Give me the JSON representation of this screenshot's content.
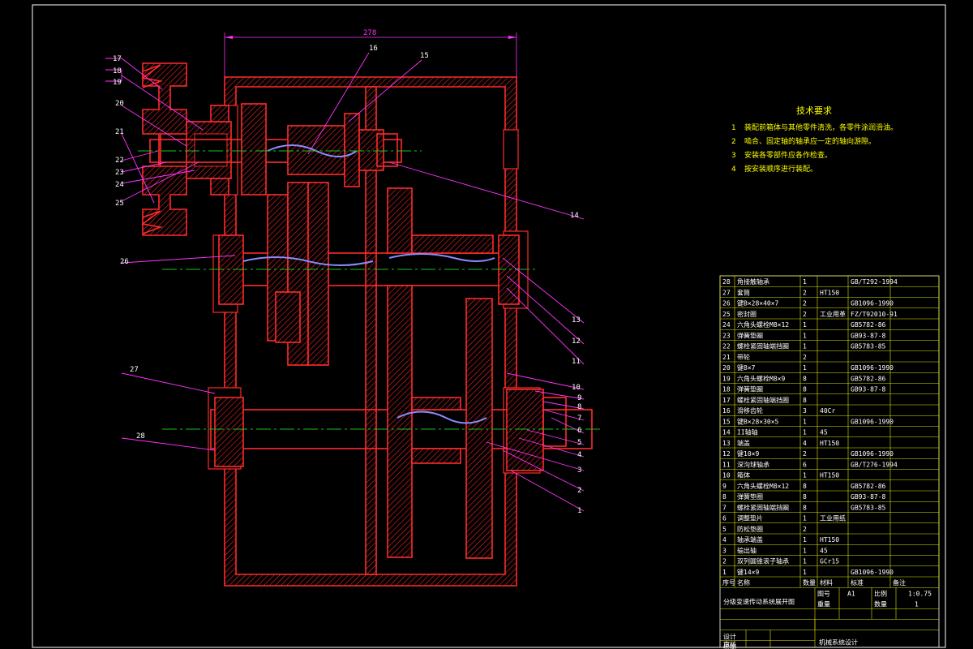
{
  "dimension": {
    "overall_width": "278"
  },
  "technical_requirements": {
    "title": "技术要求",
    "items": [
      {
        "no": "1",
        "text": "装配前箱体与其他零件清洗，各零件涂润滑油。"
      },
      {
        "no": "2",
        "text": "啮合、固定轴的轴承应一定的轴向游隙。"
      },
      {
        "no": "3",
        "text": "安装各零部件应各作检查。"
      },
      {
        "no": "4",
        "text": "按安装顺序进行装配。"
      }
    ]
  },
  "callouts": {
    "c17": "17",
    "c18": "18",
    "c19": "19",
    "c20": "20",
    "c21": "21",
    "c22": "22",
    "c23": "23",
    "c24": "24",
    "c25": "25",
    "c16a": "16",
    "c16b": "15",
    "c14": "14",
    "c26": "26",
    "c13": "13",
    "c12": "12",
    "c11": "11",
    "c27": "27",
    "c10": "10",
    "c9": "9",
    "c8": "8",
    "c7": "7",
    "c6": "6",
    "c5": "5",
    "c4": "4",
    "c3": "3",
    "c2": "2",
    "c1": "1",
    "c28": "28"
  },
  "bom": {
    "rows": [
      {
        "no": "28",
        "name": "角接触轴承",
        "qty": "1",
        "material": "",
        "standard": "GB/T292-1994",
        "note": ""
      },
      {
        "no": "27",
        "name": "套筒",
        "qty": "2",
        "material": "HT150",
        "standard": "",
        "note": ""
      },
      {
        "no": "26",
        "name": "键B×28×40×7",
        "qty": "2",
        "material": "",
        "standard": "GB1096-1990",
        "note": ""
      },
      {
        "no": "25",
        "name": "密封圈",
        "qty": "2",
        "material": "工业用革",
        "standard": "FZ/T92010-91",
        "note": ""
      },
      {
        "no": "24",
        "name": "六角头螺栓M8×12",
        "qty": "1",
        "material": "",
        "standard": "GB5782-86",
        "note": ""
      },
      {
        "no": "23",
        "name": "弹簧垫圈",
        "qty": "1",
        "material": "",
        "standard": "GB93-87-8",
        "note": ""
      },
      {
        "no": "22",
        "name": "螺栓紧固轴端挡圈",
        "qty": "1",
        "material": "",
        "standard": "GB5783-85",
        "note": ""
      },
      {
        "no": "21",
        "name": "带轮",
        "qty": "2",
        "material": "",
        "standard": "",
        "note": ""
      },
      {
        "no": "20",
        "name": "键8×7",
        "qty": "1",
        "material": "",
        "standard": "GB1096-1990",
        "note": ""
      },
      {
        "no": "19",
        "name": "六角头螺栓M8×9",
        "qty": "8",
        "material": "",
        "standard": "GB5782-86",
        "note": ""
      },
      {
        "no": "18",
        "name": "弹簧垫圈",
        "qty": "8",
        "material": "",
        "standard": "GB93-87-8",
        "note": ""
      },
      {
        "no": "17",
        "name": "螺栓紧固轴端挡圈",
        "qty": "8",
        "material": "",
        "standard": "",
        "note": ""
      },
      {
        "no": "16",
        "name": "滑移齿轮",
        "qty": "3",
        "material": "40Cr",
        "standard": "",
        "note": ""
      },
      {
        "no": "15",
        "name": "键B×28×30×5",
        "qty": "1",
        "material": "",
        "standard": "GB1096-1990",
        "note": ""
      },
      {
        "no": "14",
        "name": "II轴轴",
        "qty": "1",
        "material": "45",
        "standard": "",
        "note": ""
      },
      {
        "no": "13",
        "name": "端盖",
        "qty": "4",
        "material": "HT150",
        "standard": "",
        "note": ""
      },
      {
        "no": "12",
        "name": "键10×9",
        "qty": "2",
        "material": "",
        "standard": "GB1096-1990",
        "note": ""
      },
      {
        "no": "11",
        "name": "深沟球轴承",
        "qty": "6",
        "material": "",
        "standard": "GB/T276-1994",
        "note": ""
      },
      {
        "no": "10",
        "name": "箱体",
        "qty": "1",
        "material": "HT150",
        "standard": "",
        "note": ""
      },
      {
        "no": "9",
        "name": "六角头螺栓M8×12",
        "qty": "8",
        "material": "",
        "standard": "GB5782-86",
        "note": ""
      },
      {
        "no": "8",
        "name": "弹簧垫圈",
        "qty": "8",
        "material": "",
        "standard": "GB93-87-8",
        "note": ""
      },
      {
        "no": "7",
        "name": "螺栓紧固轴端挡圈",
        "qty": "8",
        "material": "",
        "standard": "GB5783-85",
        "note": ""
      },
      {
        "no": "6",
        "name": "调整垫片",
        "qty": "1",
        "material": "工业用纸",
        "standard": "",
        "note": ""
      },
      {
        "no": "5",
        "name": "防松垫圈",
        "qty": "2",
        "material": "",
        "standard": "",
        "note": ""
      },
      {
        "no": "4",
        "name": "轴承端盖",
        "qty": "1",
        "material": "HT150",
        "standard": "",
        "note": ""
      },
      {
        "no": "3",
        "name": "输出轴",
        "qty": "1",
        "material": "45",
        "standard": "",
        "note": ""
      },
      {
        "no": "2",
        "name": "双列圆锥滚子轴承",
        "qty": "1",
        "material": "GCr15",
        "standard": "",
        "note": ""
      },
      {
        "no": "1",
        "name": "键14×9",
        "qty": "1",
        "material": "",
        "standard": "GB1096-1990",
        "note": ""
      }
    ],
    "header": {
      "no": "序号",
      "name": "名称",
      "qty": "数量",
      "material": "材料",
      "standard": "标准",
      "note": "备注"
    }
  },
  "title_block": {
    "drawing_title": "分级变速传动系统展开图",
    "label_sheet": "图号",
    "sheet": "A1",
    "label_scale": "比例",
    "scale": "1:0.75",
    "label_weight": "重量",
    "label_qty": "数量",
    "qty": "1",
    "label_design": "设计",
    "label_draw": "绘图",
    "label_review": "审核",
    "project": "机械系统设计"
  }
}
